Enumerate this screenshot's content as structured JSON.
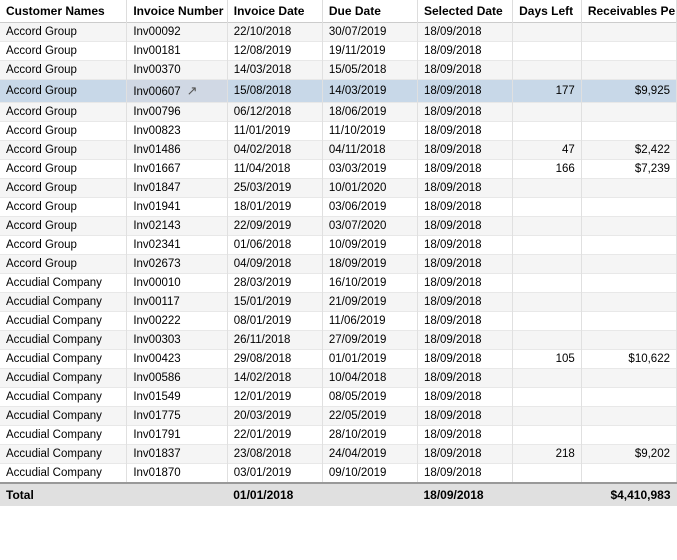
{
  "table": {
    "headers": [
      "Customer Names",
      "Invoice Number",
      "Invoice Date",
      "Due Date",
      "Selected Date",
      "Days Left",
      "Receivables Per Group"
    ],
    "rows": [
      {
        "customer": "Accord Group",
        "invoice": "Inv00092",
        "inv_date": "22/10/2018",
        "due_date": "30/07/2019",
        "sel_date": "18/09/2018",
        "days_left": "",
        "recv": "",
        "highlight": false
      },
      {
        "customer": "Accord Group",
        "invoice": "Inv00181",
        "inv_date": "12/08/2019",
        "due_date": "19/11/2019",
        "sel_date": "18/09/2018",
        "days_left": "",
        "recv": "",
        "highlight": false
      },
      {
        "customer": "Accord Group",
        "invoice": "Inv00370",
        "inv_date": "14/03/2018",
        "due_date": "15/05/2018",
        "sel_date": "18/09/2018",
        "days_left": "",
        "recv": "",
        "highlight": false
      },
      {
        "customer": "Accord Group",
        "invoice": "Inv00607",
        "inv_date": "15/08/2018",
        "due_date": "14/03/2019",
        "sel_date": "18/09/2018",
        "days_left": "177",
        "recv": "$9,925",
        "highlight": true
      },
      {
        "customer": "Accord Group",
        "invoice": "Inv00796",
        "inv_date": "06/12/2018",
        "due_date": "18/06/2019",
        "sel_date": "18/09/2018",
        "days_left": "",
        "recv": "",
        "highlight": false
      },
      {
        "customer": "Accord Group",
        "invoice": "Inv00823",
        "inv_date": "11/01/2019",
        "due_date": "11/10/2019",
        "sel_date": "18/09/2018",
        "days_left": "",
        "recv": "",
        "highlight": false
      },
      {
        "customer": "Accord Group",
        "invoice": "Inv01486",
        "inv_date": "04/02/2018",
        "due_date": "04/11/2018",
        "sel_date": "18/09/2018",
        "days_left": "47",
        "recv": "$2,422",
        "highlight": false
      },
      {
        "customer": "Accord Group",
        "invoice": "Inv01667",
        "inv_date": "11/04/2018",
        "due_date": "03/03/2019",
        "sel_date": "18/09/2018",
        "days_left": "166",
        "recv": "$7,239",
        "highlight": false
      },
      {
        "customer": "Accord Group",
        "invoice": "Inv01847",
        "inv_date": "25/03/2019",
        "due_date": "10/01/2020",
        "sel_date": "18/09/2018",
        "days_left": "",
        "recv": "",
        "highlight": false
      },
      {
        "customer": "Accord Group",
        "invoice": "Inv01941",
        "inv_date": "18/01/2019",
        "due_date": "03/06/2019",
        "sel_date": "18/09/2018",
        "days_left": "",
        "recv": "",
        "highlight": false
      },
      {
        "customer": "Accord Group",
        "invoice": "Inv02143",
        "inv_date": "22/09/2019",
        "due_date": "03/07/2020",
        "sel_date": "18/09/2018",
        "days_left": "",
        "recv": "",
        "highlight": false
      },
      {
        "customer": "Accord Group",
        "invoice": "Inv02341",
        "inv_date": "01/06/2018",
        "due_date": "10/09/2019",
        "sel_date": "18/09/2018",
        "days_left": "",
        "recv": "",
        "highlight": false
      },
      {
        "customer": "Accord Group",
        "invoice": "Inv02673",
        "inv_date": "04/09/2018",
        "due_date": "18/09/2019",
        "sel_date": "18/09/2018",
        "days_left": "",
        "recv": "",
        "highlight": false
      },
      {
        "customer": "Accudial Company",
        "invoice": "Inv00010",
        "inv_date": "28/03/2019",
        "due_date": "16/10/2019",
        "sel_date": "18/09/2018",
        "days_left": "",
        "recv": "",
        "highlight": false
      },
      {
        "customer": "Accudial Company",
        "invoice": "Inv00117",
        "inv_date": "15/01/2019",
        "due_date": "21/09/2019",
        "sel_date": "18/09/2018",
        "days_left": "",
        "recv": "",
        "highlight": false
      },
      {
        "customer": "Accudial Company",
        "invoice": "Inv00222",
        "inv_date": "08/01/2019",
        "due_date": "11/06/2019",
        "sel_date": "18/09/2018",
        "days_left": "",
        "recv": "",
        "highlight": false
      },
      {
        "customer": "Accudial Company",
        "invoice": "Inv00303",
        "inv_date": "26/11/2018",
        "due_date": "27/09/2019",
        "sel_date": "18/09/2018",
        "days_left": "",
        "recv": "",
        "highlight": false
      },
      {
        "customer": "Accudial Company",
        "invoice": "Inv00423",
        "inv_date": "29/08/2018",
        "due_date": "01/01/2019",
        "sel_date": "18/09/2018",
        "days_left": "105",
        "recv": "$10,622",
        "highlight": false
      },
      {
        "customer": "Accudial Company",
        "invoice": "Inv00586",
        "inv_date": "14/02/2018",
        "due_date": "10/04/2018",
        "sel_date": "18/09/2018",
        "days_left": "",
        "recv": "",
        "highlight": false
      },
      {
        "customer": "Accudial Company",
        "invoice": "Inv01549",
        "inv_date": "12/01/2019",
        "due_date": "08/05/2019",
        "sel_date": "18/09/2018",
        "days_left": "",
        "recv": "",
        "highlight": false
      },
      {
        "customer": "Accudial Company",
        "invoice": "Inv01775",
        "inv_date": "20/03/2019",
        "due_date": "22/05/2019",
        "sel_date": "18/09/2018",
        "days_left": "",
        "recv": "",
        "highlight": false
      },
      {
        "customer": "Accudial Company",
        "invoice": "Inv01791",
        "inv_date": "22/01/2019",
        "due_date": "28/10/2019",
        "sel_date": "18/09/2018",
        "days_left": "",
        "recv": "",
        "highlight": false
      },
      {
        "customer": "Accudial Company",
        "invoice": "Inv01837",
        "inv_date": "23/08/2018",
        "due_date": "24/04/2019",
        "sel_date": "18/09/2018",
        "days_left": "218",
        "recv": "$9,202",
        "highlight": false
      },
      {
        "customer": "Accudial Company",
        "invoice": "Inv01870",
        "inv_date": "03/01/2019",
        "due_date": "09/10/2019",
        "sel_date": "18/09/2018",
        "days_left": "",
        "recv": "",
        "highlight": false
      }
    ],
    "footer": {
      "label": "Total",
      "inv_date": "01/01/2018",
      "sel_date": "18/09/2018",
      "recv": "$4,410,983"
    }
  }
}
